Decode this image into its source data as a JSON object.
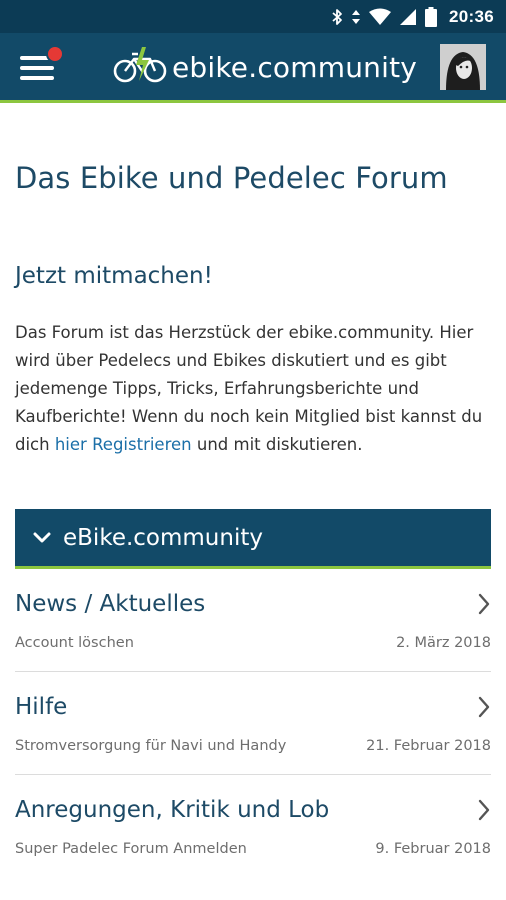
{
  "status_bar": {
    "time": "20:36",
    "icons": [
      "bluetooth-icon",
      "data-arrows-icon",
      "wifi-icon",
      "signal-icon",
      "battery-icon"
    ]
  },
  "app_bar": {
    "brand_name": "ebike.community",
    "menu_badge": true,
    "colors": {
      "bar": "#124a68",
      "accent": "#8cc63f",
      "badge": "#e53935"
    }
  },
  "page": {
    "title": "Das Ebike und Pedelec Forum",
    "section_title": "Jetzt mitmachen!",
    "intro_before": "Das Forum ist das Herzstück der ebike.community. Hier wird über Pedelecs und Ebikes diskutiert und es gibt jedemenge Tipps, Tricks, Erfahrungsberichte und Kaufberichte! Wenn du noch kein Mitglied bist kannst du dich ",
    "intro_link": "hier Registrieren",
    "intro_after": " und mit diskutieren."
  },
  "category": {
    "title": "eBike.community",
    "forums": [
      {
        "title": "News / Aktuelles",
        "last_topic": "Account löschen",
        "date": "2. März 2018"
      },
      {
        "title": "Hilfe",
        "last_topic": "Stromversorgung für Navi und Handy",
        "date": "21. Februar 2018"
      },
      {
        "title": "Anregungen, Kritik und Lob",
        "last_topic": "Super Padelec Forum Anmelden",
        "date": "9. Februar 2018"
      }
    ]
  }
}
